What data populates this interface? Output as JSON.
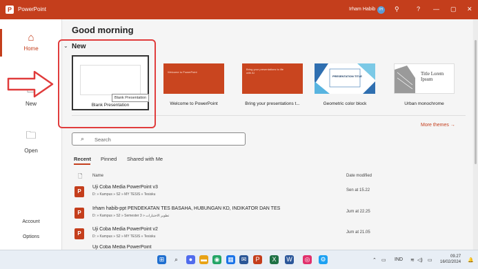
{
  "titlebar": {
    "app_name": "PowerPoint",
    "user_name": "Irham Habib",
    "user_initials": "IH",
    "icons": [
      "rocket-icon",
      "help-icon",
      "minimize-icon",
      "maximize-icon",
      "close-icon"
    ]
  },
  "sidebar": {
    "home": "Home",
    "new": "New",
    "open": "Open",
    "account": "Account",
    "options": "Options"
  },
  "main": {
    "greeting": "Good morning",
    "new_section": "New",
    "templates": [
      {
        "label": "Blank Presentation"
      },
      {
        "label": "Welcome to PowerPoint",
        "thumb_text": "Welcome to PowerPoint"
      },
      {
        "label": "Bring your presentations t...",
        "thumb_text": "Bring your presentations to life with AI"
      },
      {
        "label": "Geometric color block",
        "thumb_text": "PRESENTATION TITLE"
      },
      {
        "label": "Urban monochrome",
        "thumb_text": "Title Lorem Ipsum"
      }
    ],
    "tooltip": "Blank Presentation",
    "more_themes": "More themes",
    "search_placeholder": "Search",
    "tabs": [
      "Recent",
      "Pinned",
      "Shared with Me"
    ],
    "columns": {
      "name": "Name",
      "date": "Date modified"
    },
    "files": [
      {
        "name": "Uji Coba Media PowerPoint v3",
        "path": "D: » Kampus » S2 » MY TESIS » Tesisku",
        "date": "Sen at 15.22"
      },
      {
        "name": "Irham habib-ppt PENDEKATAN TES BASAHA, HUBUNGAN KD, INDIKATOR DAN TES",
        "path": "D: » Kampus » S2 » Semester 3 » تطوير الاختبارات",
        "date": "Jum at 22.25"
      },
      {
        "name": "Uji Coba Media PowerPoint v2",
        "path": "D: » Kampus » S2 » MY TESIS » Tesisku",
        "date": "Jum at 21.05"
      },
      {
        "name": "Uji Coba Media PowerPoint",
        "path": "",
        "date": ""
      }
    ]
  },
  "taskbar": {
    "tray_lang": "IND",
    "time": "09.27",
    "date": "16/02/2024"
  },
  "colors": {
    "accent": "#c43e1c",
    "highlight": "#e03b3b"
  }
}
